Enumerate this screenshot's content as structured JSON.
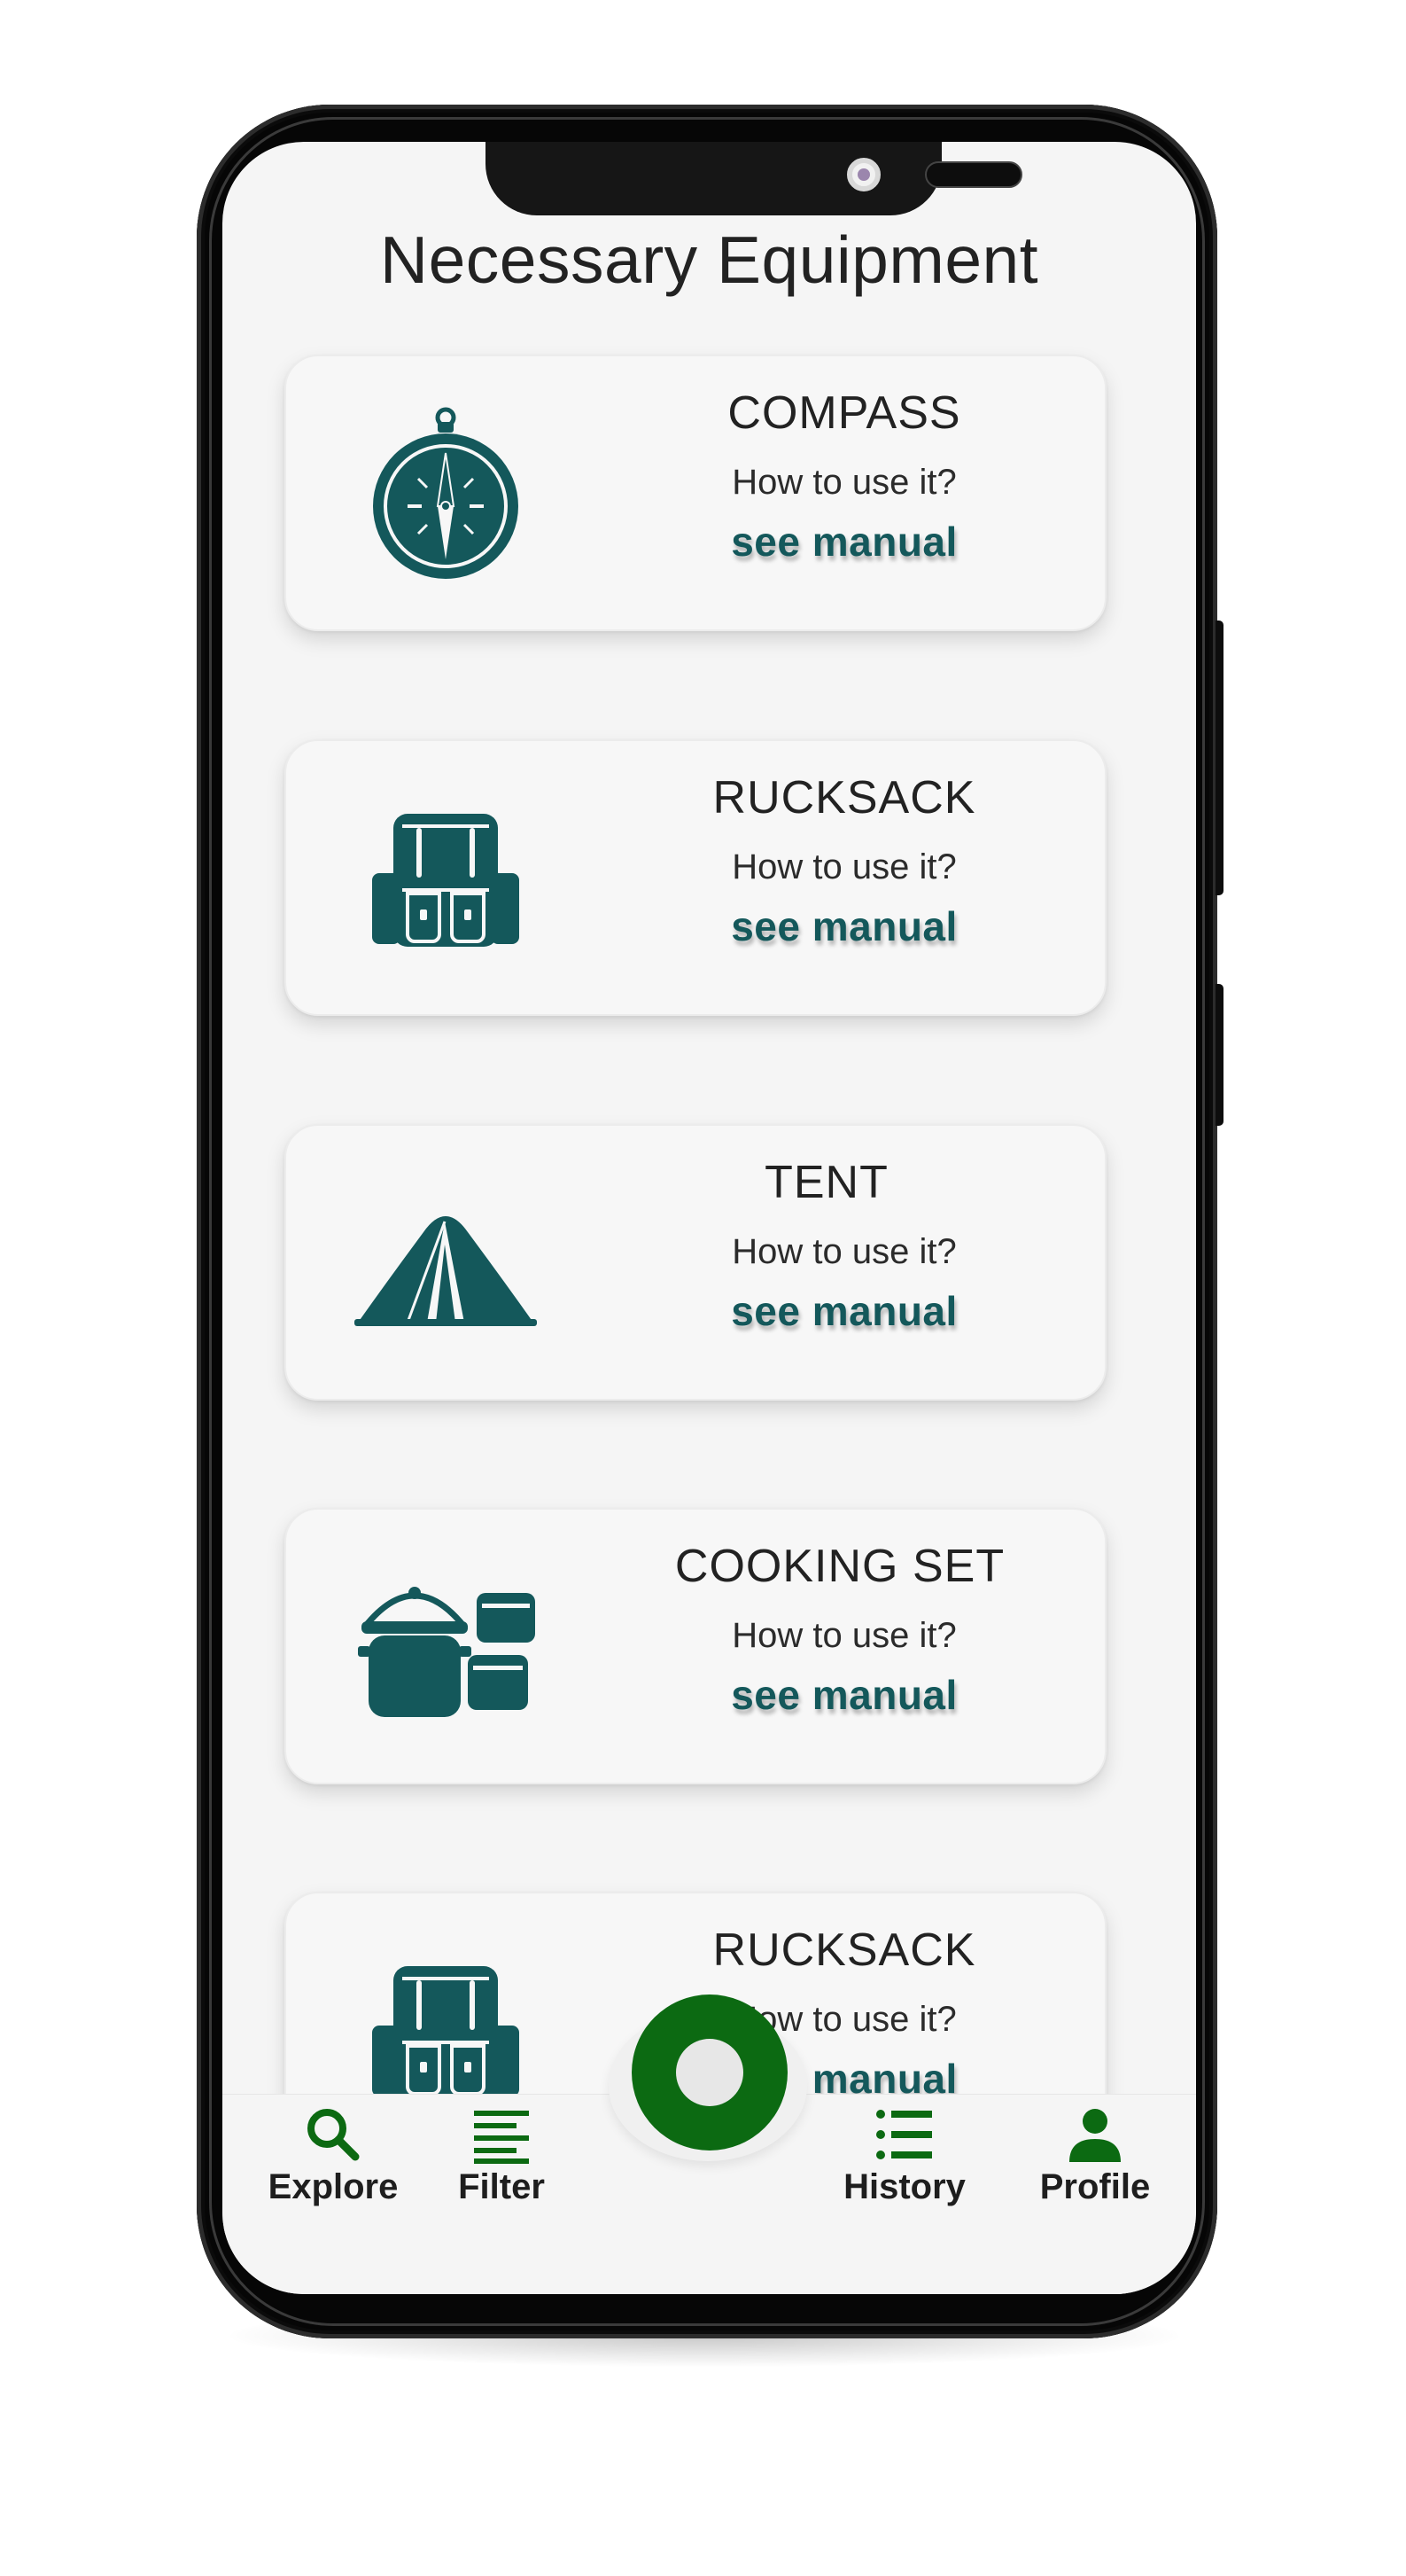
{
  "page": {
    "title": "Necessary Equipment"
  },
  "colors": {
    "icon_teal": "#14585b",
    "nav_green": "#0c6a12",
    "card_bg": "#f7f7f7",
    "screen_bg": "#f5f5f5"
  },
  "equipment": [
    {
      "name": "COMPASS",
      "subtitle": "How to use it?",
      "link": "see manual",
      "icon": "compass-icon"
    },
    {
      "name": "RUCKSACK",
      "subtitle": "How to use it?",
      "link": "see manual",
      "icon": "rucksack-icon"
    },
    {
      "name": "TENT",
      "subtitle": "How to use it?",
      "link": "see manual",
      "icon": "tent-icon"
    },
    {
      "name": "COOKING SET",
      "subtitle": "How to use it?",
      "link": "see manual",
      "icon": "cooking-set-icon"
    },
    {
      "name": "RUCKSACK",
      "subtitle": "How to use it?",
      "link": "see manual",
      "icon": "rucksack-icon"
    }
  ],
  "bottom_nav": {
    "items": [
      {
        "label": "Explore",
        "icon": "search-icon"
      },
      {
        "label": "Filter",
        "icon": "filter-lines-icon"
      },
      {
        "label": "History",
        "icon": "list-icon"
      },
      {
        "label": "Profile",
        "icon": "person-icon"
      }
    ],
    "center_button_icon": "ring-icon"
  }
}
